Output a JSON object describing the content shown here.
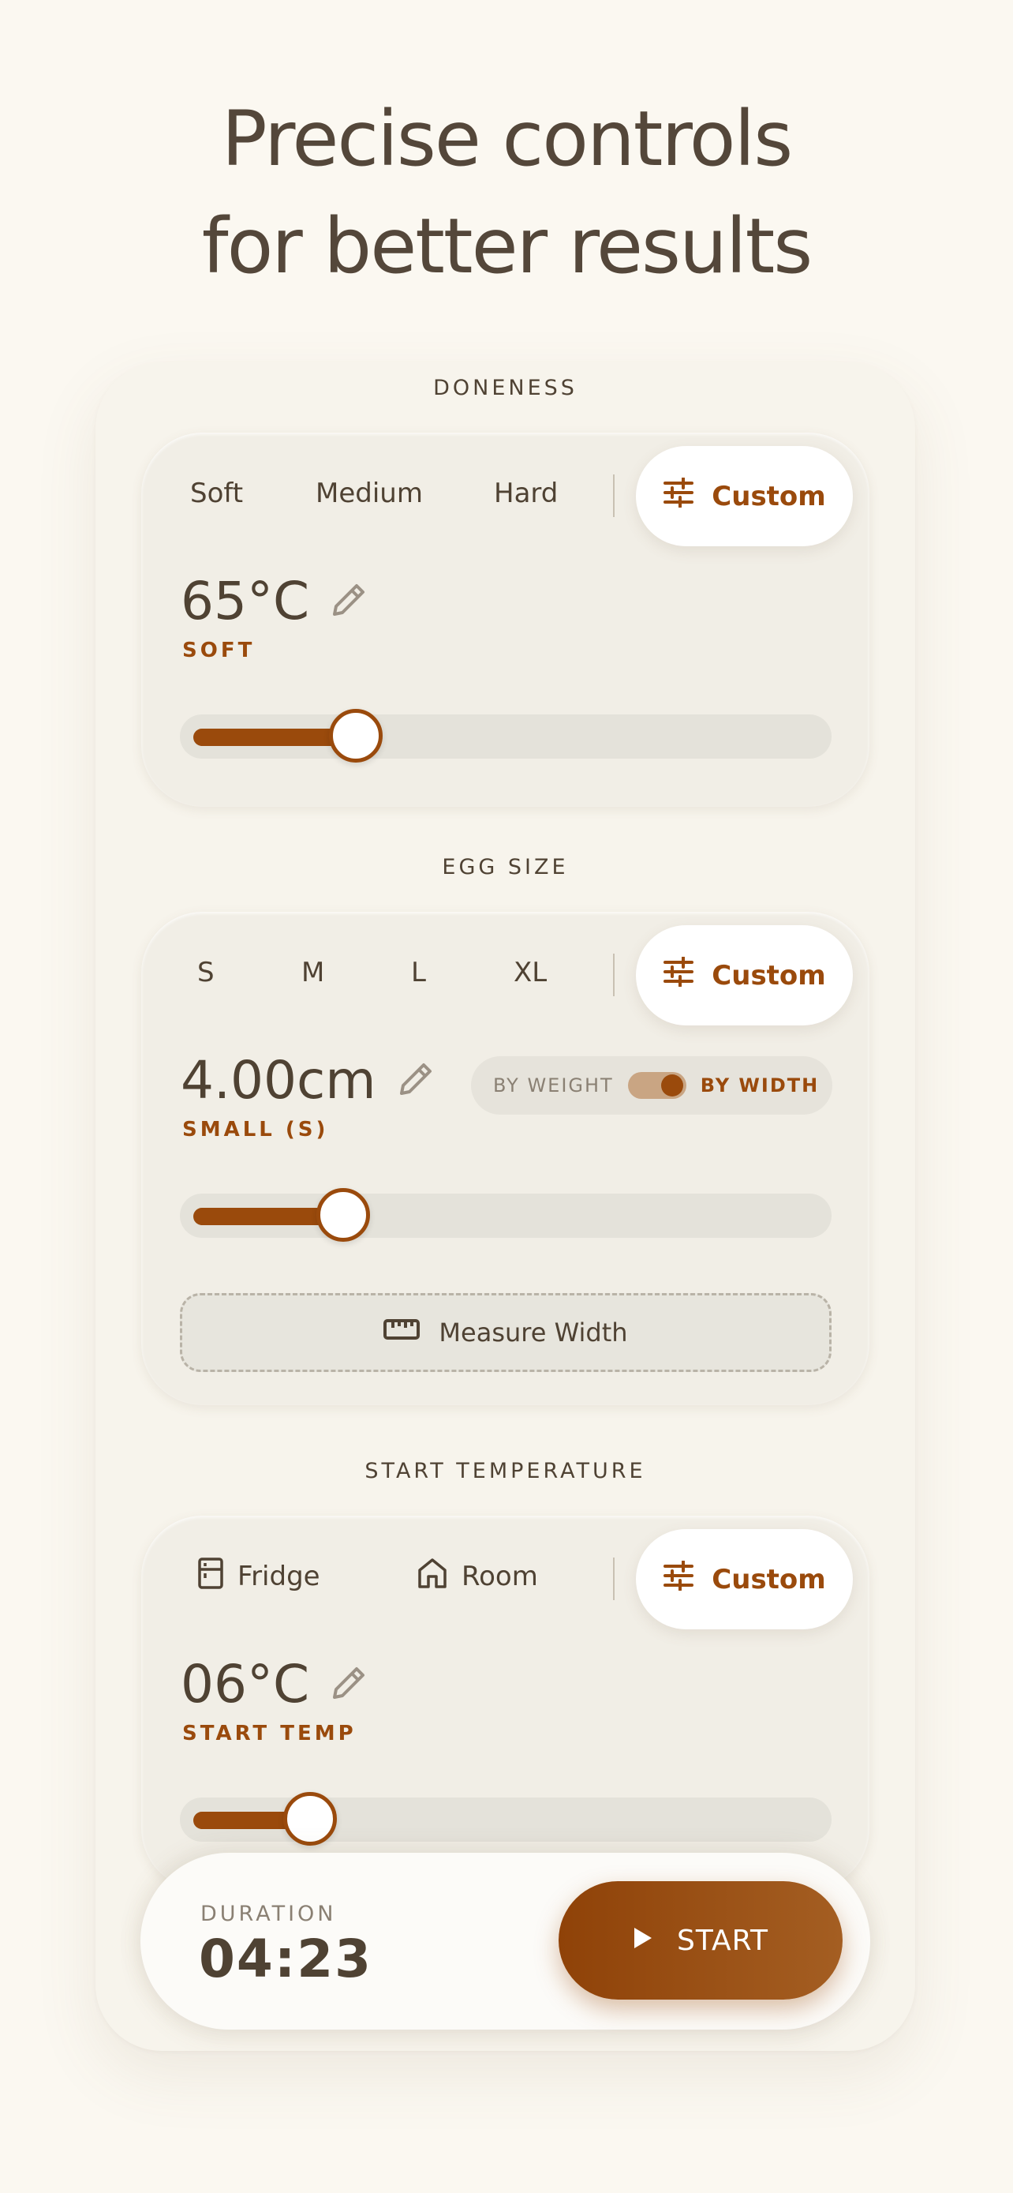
{
  "headline": {
    "line1": "Precise controls",
    "line2": "for better results"
  },
  "colors": {
    "accent": "#9a4a0c",
    "background": "#fbf8f1",
    "card": "#f1eee6",
    "text": "#4f4233"
  },
  "doneness": {
    "section_label": "DONENESS",
    "options": [
      "Soft",
      "Medium",
      "Hard"
    ],
    "custom_label": "Custom",
    "custom_icon": "sliders-icon",
    "value": "65°C",
    "edit_icon": "pencil-icon",
    "sublabel": "SOFT",
    "slider_fraction": 0.27
  },
  "egg_size": {
    "section_label": "EGG SIZE",
    "options": [
      "S",
      "M",
      "L",
      "XL"
    ],
    "custom_label": "Custom",
    "value": "4.00cm",
    "sublabel": "SMALL (S)",
    "toggle": {
      "left": "BY WEIGHT",
      "right": "BY WIDTH",
      "selected": "BY WIDTH"
    },
    "slider_fraction": 0.25,
    "measure_label": "Measure Width",
    "measure_icon": "ruler-icon"
  },
  "start_temp": {
    "section_label": "START TEMPERATURE",
    "options": [
      {
        "label": "Fridge",
        "icon": "fridge-icon"
      },
      {
        "label": "Room",
        "icon": "home-icon"
      }
    ],
    "custom_label": "Custom",
    "value": "06°C",
    "sublabel": "START TEMP",
    "slider_fraction": 0.2
  },
  "bottom_bar": {
    "duration_label": "DURATION",
    "duration_value": "04:23",
    "start_label": "START",
    "start_icon": "play-icon"
  }
}
